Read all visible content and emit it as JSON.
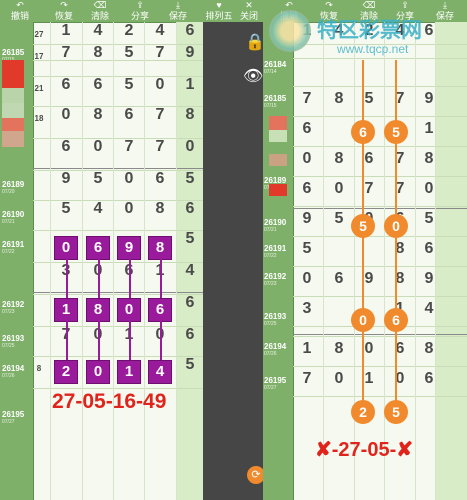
{
  "toolbar": {
    "left": [
      {
        "icon": "↶",
        "label": "撤销"
      },
      {
        "icon": "↷",
        "label": "恢复"
      },
      {
        "icon": "⌫",
        "label": "清除"
      },
      {
        "icon": "⇪",
        "label": "分享"
      },
      {
        "icon": "⤓",
        "label": "保存"
      }
    ],
    "middle": [
      {
        "icon": "♥",
        "label": "排列五"
      },
      {
        "icon": "✕",
        "label": "关闭"
      }
    ],
    "right": [
      {
        "icon": "↶",
        "label": "撤销"
      },
      {
        "icon": "↷",
        "label": "恢复"
      },
      {
        "icon": "⌫",
        "label": "清除"
      },
      {
        "icon": "⇪",
        "label": "分享"
      },
      {
        "icon": "⤓",
        "label": "保存"
      }
    ]
  },
  "watermark": {
    "brand": "特区彩票网",
    "url": "www.tqcp.net"
  },
  "left": {
    "issues": [
      {
        "num": "26185",
        "date": "07/15"
      },
      {
        "num": "26189",
        "date": "07/20"
      },
      {
        "num": "26190",
        "date": "07/21"
      },
      {
        "num": "26191",
        "date": "07/22"
      },
      {
        "num": "26192",
        "date": "07/23"
      },
      {
        "num": "26193",
        "date": "07/25"
      },
      {
        "num": "26194",
        "date": "07/26"
      },
      {
        "num": "26195",
        "date": "07/27"
      }
    ],
    "small_nums": [
      "27",
      "17",
      "21",
      "18",
      "",
      "",
      "",
      "",
      "",
      "",
      "",
      "8"
    ],
    "rows": [
      [
        "1",
        "4",
        "2",
        "4",
        "6"
      ],
      [
        "7",
        "8",
        "5",
        "7",
        "9"
      ],
      [
        "6",
        "6",
        "5",
        "0",
        "1"
      ],
      [
        "0",
        "8",
        "6",
        "7",
        "8"
      ],
      [
        "6",
        "0",
        "7",
        "7",
        "0"
      ],
      [
        "9",
        "5",
        "0",
        "6",
        "5"
      ],
      [
        "5",
        "4",
        "0",
        "8",
        "6"
      ],
      [
        "",
        "",
        "",
        "",
        "5"
      ],
      [
        "3",
        "0",
        "6",
        "1",
        "4"
      ],
      [
        "",
        "",
        "",
        "",
        "6"
      ],
      [
        "7",
        "0",
        "1",
        "0",
        "6"
      ],
      [
        "",
        "",
        "",
        "",
        "5"
      ]
    ],
    "boxes": [
      [
        "0",
        "6",
        "9",
        "8"
      ],
      [
        "1",
        "8",
        "0",
        "6"
      ],
      [
        "2",
        "0",
        "1",
        "4"
      ]
    ],
    "annotation": "27-05-16-49"
  },
  "right": {
    "issues": [
      {
        "num": "26184",
        "date": "07/14"
      },
      {
        "num": "26185",
        "date": "07/15"
      },
      {
        "num": "26189",
        "date": "07/20"
      },
      {
        "num": "26190",
        "date": "07/21"
      },
      {
        "num": "26191",
        "date": "07/22"
      },
      {
        "num": "26192",
        "date": "07/23"
      },
      {
        "num": "26193",
        "date": "07/25"
      },
      {
        "num": "26194",
        "date": "07/26"
      },
      {
        "num": "26195",
        "date": "07/27"
      }
    ],
    "rows": [
      [
        "1",
        "4",
        "2",
        "4",
        "6"
      ],
      [
        "7",
        "8",
        "5",
        "7",
        "9"
      ],
      [
        "6",
        "",
        "",
        "0",
        "1"
      ],
      [
        "0",
        "8",
        "6",
        "7",
        "8"
      ],
      [
        "6",
        "0",
        "7",
        "7",
        "0"
      ],
      [
        "9",
        "5",
        "0",
        "6",
        "5"
      ],
      [
        "5",
        "",
        "",
        "8",
        "6"
      ],
      [
        "0",
        "6",
        "9",
        "8",
        "9"
      ],
      [
        "3",
        "",
        "",
        "1",
        "4"
      ],
      [
        "1",
        "8",
        "0",
        "6",
        "8"
      ],
      [
        "7",
        "0",
        "1",
        "0",
        "6"
      ]
    ],
    "circles": [
      [
        "6",
        "5"
      ],
      [
        "5",
        "0"
      ],
      [
        "0",
        "6"
      ],
      [
        "2",
        "5"
      ]
    ],
    "annotation": "✘-27-05-✘"
  },
  "colors": {
    "purple": "#9a1a9c",
    "orange": "#f08a2c",
    "red_annot": "#e0241c",
    "green": "#7fb06a"
  }
}
